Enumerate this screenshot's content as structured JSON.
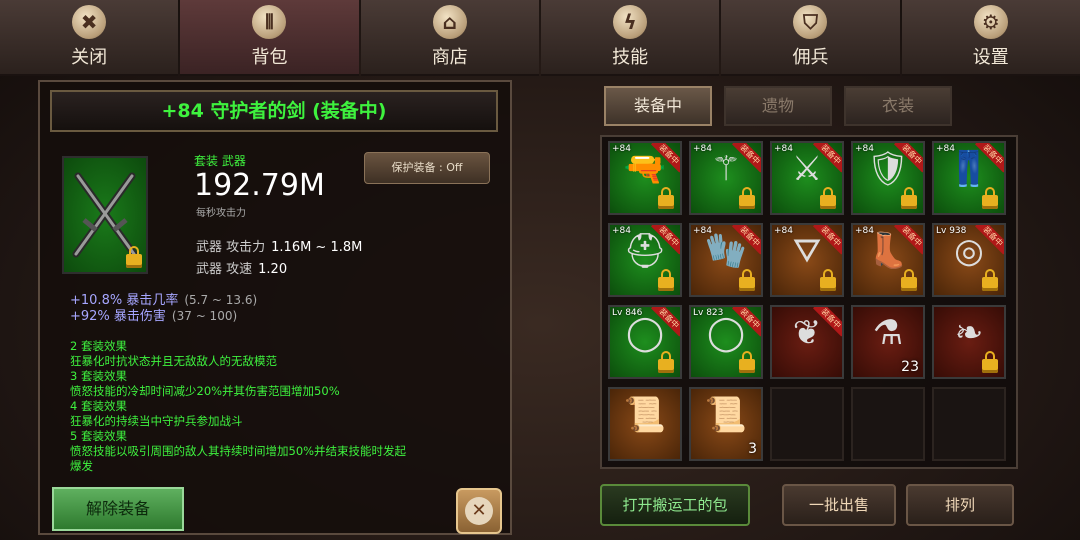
{
  "nav": [
    {
      "label": "关闭",
      "icon": "close-icon",
      "glyph": "✖",
      "active": false
    },
    {
      "label": "背包",
      "icon": "backpack-icon",
      "glyph": "⫴",
      "active": true
    },
    {
      "label": "商店",
      "icon": "shop-icon",
      "glyph": "⌂",
      "active": false
    },
    {
      "label": "技能",
      "icon": "skill-lightning-icon",
      "glyph": "ϟ",
      "active": false
    },
    {
      "label": "佣兵",
      "icon": "mercenary-shield-icon",
      "glyph": "⛉",
      "active": false
    },
    {
      "label": "设置",
      "icon": "gear-icon",
      "glyph": "⚙",
      "active": false
    }
  ],
  "item": {
    "title": "+84 守护者的剑 (装备中)",
    "set_label": "套装 武器",
    "power": "192.79M",
    "power_label": "每秒攻击力",
    "protect_button": "保护装备 : Off",
    "icon": "crossed-swords-icon",
    "stats": [
      {
        "k": "武器 攻击力",
        "v": "1.16M ~ 1.8M"
      },
      {
        "k": "武器 攻速",
        "v": "1.20"
      }
    ],
    "bonuses": [
      {
        "v": "+10.8% 暴击几率",
        "r": "(5.7 ~ 13.6)"
      },
      {
        "v": "+92% 暴击伤害",
        "r": "(37 ~ 100)"
      }
    ],
    "effects": [
      "2 套装效果",
      "狂暴化时抗状态并且无敌敌人的无敌模范",
      "3 套装效果",
      "愤怒技能的冷却时间减少20%并其伤害范围增加50%",
      "4 套装效果",
      "狂暴化的持续当中守护兵参加战斗",
      "5 套装效果",
      "愤怒技能以吸引周围的敌人其持续时间增加50%并结束技能时发起",
      "爆发"
    ],
    "unequip_label": "解除装备"
  },
  "right_tabs": [
    {
      "label": "装备中",
      "active": true
    },
    {
      "label": "遗物",
      "active": false
    },
    {
      "label": "衣装",
      "active": false
    }
  ],
  "slots": [
    {
      "bg": "green",
      "plus": "+84",
      "equipped": true,
      "lock": true,
      "glyph": "🔫",
      "qty": ""
    },
    {
      "bg": "green",
      "plus": "+84",
      "equipped": true,
      "lock": true,
      "glyph": "⚚",
      "qty": ""
    },
    {
      "bg": "green",
      "plus": "+84",
      "equipped": true,
      "lock": true,
      "glyph": "⚔",
      "qty": ""
    },
    {
      "bg": "green",
      "plus": "+84",
      "equipped": true,
      "lock": true,
      "glyph": "🛡",
      "qty": ""
    },
    {
      "bg": "green",
      "plus": "+84",
      "equipped": true,
      "lock": true,
      "glyph": "👖",
      "qty": ""
    },
    {
      "bg": "green",
      "plus": "+84",
      "equipped": true,
      "lock": true,
      "glyph": "⛑",
      "qty": ""
    },
    {
      "bg": "brown",
      "plus": "+84",
      "equipped": true,
      "lock": true,
      "glyph": "🧤",
      "qty": ""
    },
    {
      "bg": "brown",
      "plus": "+84",
      "equipped": true,
      "lock": true,
      "glyph": "⛛",
      "qty": ""
    },
    {
      "bg": "brown",
      "plus": "+84",
      "equipped": true,
      "lock": true,
      "glyph": "👢",
      "qty": ""
    },
    {
      "bg": "brown",
      "plus": "Lv 938",
      "equipped": true,
      "lock": true,
      "glyph": "◎",
      "qty": ""
    },
    {
      "bg": "green",
      "plus": "Lv 846",
      "equipped": true,
      "lock": true,
      "glyph": "◯",
      "qty": ""
    },
    {
      "bg": "green",
      "plus": "Lv 823",
      "equipped": true,
      "lock": true,
      "glyph": "◯",
      "qty": ""
    },
    {
      "bg": "red",
      "plus": "",
      "equipped": true,
      "lock": false,
      "glyph": "❦",
      "qty": ""
    },
    {
      "bg": "red",
      "plus": "",
      "equipped": false,
      "lock": false,
      "glyph": "⚗",
      "qty": "23"
    },
    {
      "bg": "red",
      "plus": "",
      "equipped": false,
      "lock": true,
      "glyph": "❧",
      "qty": ""
    },
    {
      "bg": "brown",
      "plus": "",
      "equipped": false,
      "lock": false,
      "glyph": "📜",
      "qty": ""
    },
    {
      "bg": "brown",
      "plus": "",
      "equipped": false,
      "lock": false,
      "glyph": "📜",
      "qty": "3"
    },
    {
      "bg": "empty",
      "plus": "",
      "equipped": false,
      "lock": false,
      "glyph": "",
      "qty": ""
    },
    {
      "bg": "empty",
      "plus": "",
      "equipped": false,
      "lock": false,
      "glyph": "",
      "qty": ""
    },
    {
      "bg": "empty",
      "plus": "",
      "equipped": false,
      "lock": false,
      "glyph": "",
      "qty": ""
    }
  ],
  "equipped_tag": "装备中",
  "bottom_buttons": [
    {
      "label": "打开搬运工的包",
      "style": "green"
    },
    {
      "label": "一批出售",
      "style": "brown"
    },
    {
      "label": "排列",
      "style": "brown"
    }
  ]
}
